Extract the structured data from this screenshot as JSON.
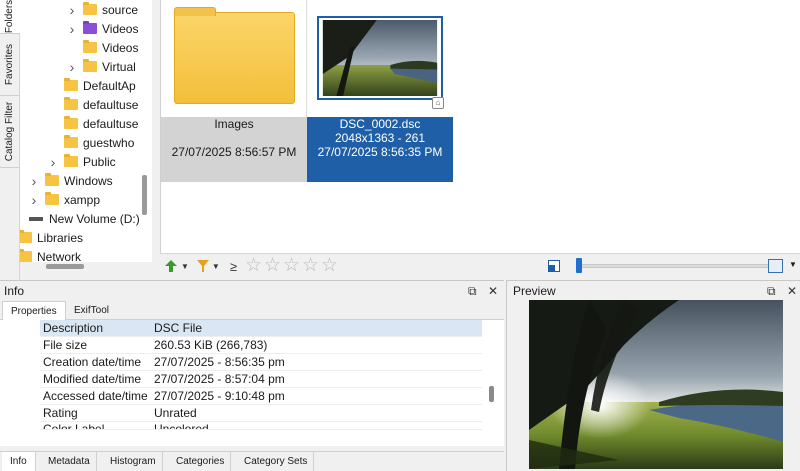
{
  "side_tabs": [
    "Folders",
    "Favorites",
    "Catalog Filter"
  ],
  "tree": [
    {
      "label": "source",
      "indent": 2,
      "expandable": true,
      "icon": "folder-icon"
    },
    {
      "label": "Videos",
      "indent": 2,
      "expandable": true,
      "icon": "video-folder-icon"
    },
    {
      "label": "Videos",
      "indent": 2,
      "expandable": false,
      "icon": "folder-icon"
    },
    {
      "label": "Virtual",
      "indent": 2,
      "expandable": true,
      "icon": "folder-icon"
    },
    {
      "label": "DefaultAp",
      "indent": 1,
      "expandable": false,
      "icon": "folder-icon"
    },
    {
      "label": "defaultuse",
      "indent": 1,
      "expandable": false,
      "icon": "folder-icon"
    },
    {
      "label": "defaultuse",
      "indent": 1,
      "expandable": false,
      "icon": "folder-icon"
    },
    {
      "label": "guestwho",
      "indent": 1,
      "expandable": false,
      "icon": "folder-icon"
    },
    {
      "label": "Public",
      "indent": 1,
      "expandable": true,
      "icon": "folder-icon"
    },
    {
      "label": "Windows",
      "indent": 0,
      "expandable": true,
      "icon": "folder-icon"
    },
    {
      "label": "xampp",
      "indent": 0,
      "expandable": true,
      "icon": "folder-icon"
    },
    {
      "label": "New Volume (D:)",
      "indent": -1,
      "expandable": false,
      "icon": "drive-icon"
    },
    {
      "label": "Libraries",
      "indent": -2,
      "expandable": false,
      "icon": "folder-icon"
    },
    {
      "label": "Network",
      "indent": -2,
      "expandable": false,
      "icon": "folder-icon"
    }
  ],
  "thumbnails": {
    "folder": {
      "name": "Images",
      "line2": "",
      "date": "27/07/2025 8:56:57 PM"
    },
    "image": {
      "name": "DSC_0002.dsc",
      "line2": "2048x1363 - 261",
      "date": "27/07/2025 8:56:35 PM"
    }
  },
  "toolbar": {
    "compare": "≥"
  },
  "info": {
    "title": "Info",
    "pin": "⧉",
    "close": "✕",
    "tabs": [
      "Properties",
      "ExifTool"
    ],
    "properties": [
      {
        "key": "Description",
        "value": "DSC File"
      },
      {
        "key": "File size",
        "value": "260.53 KiB (266,783)"
      },
      {
        "key": "Creation date/time",
        "value": "27/07/2025 - 8:56:35 pm"
      },
      {
        "key": "Modified date/time",
        "value": "27/07/2025 - 8:57:04 pm"
      },
      {
        "key": "Accessed date/time",
        "value": "27/07/2025 - 9:10:48 pm"
      },
      {
        "key": "Rating",
        "value": "Unrated"
      },
      {
        "key": "Color Label",
        "value": "Uncolored"
      }
    ],
    "bottom_tabs": [
      "Info",
      "Metadata",
      "Histogram",
      "Categories",
      "Category Sets"
    ]
  },
  "preview": {
    "title": "Preview",
    "pin": "⧉",
    "close": "✕"
  }
}
